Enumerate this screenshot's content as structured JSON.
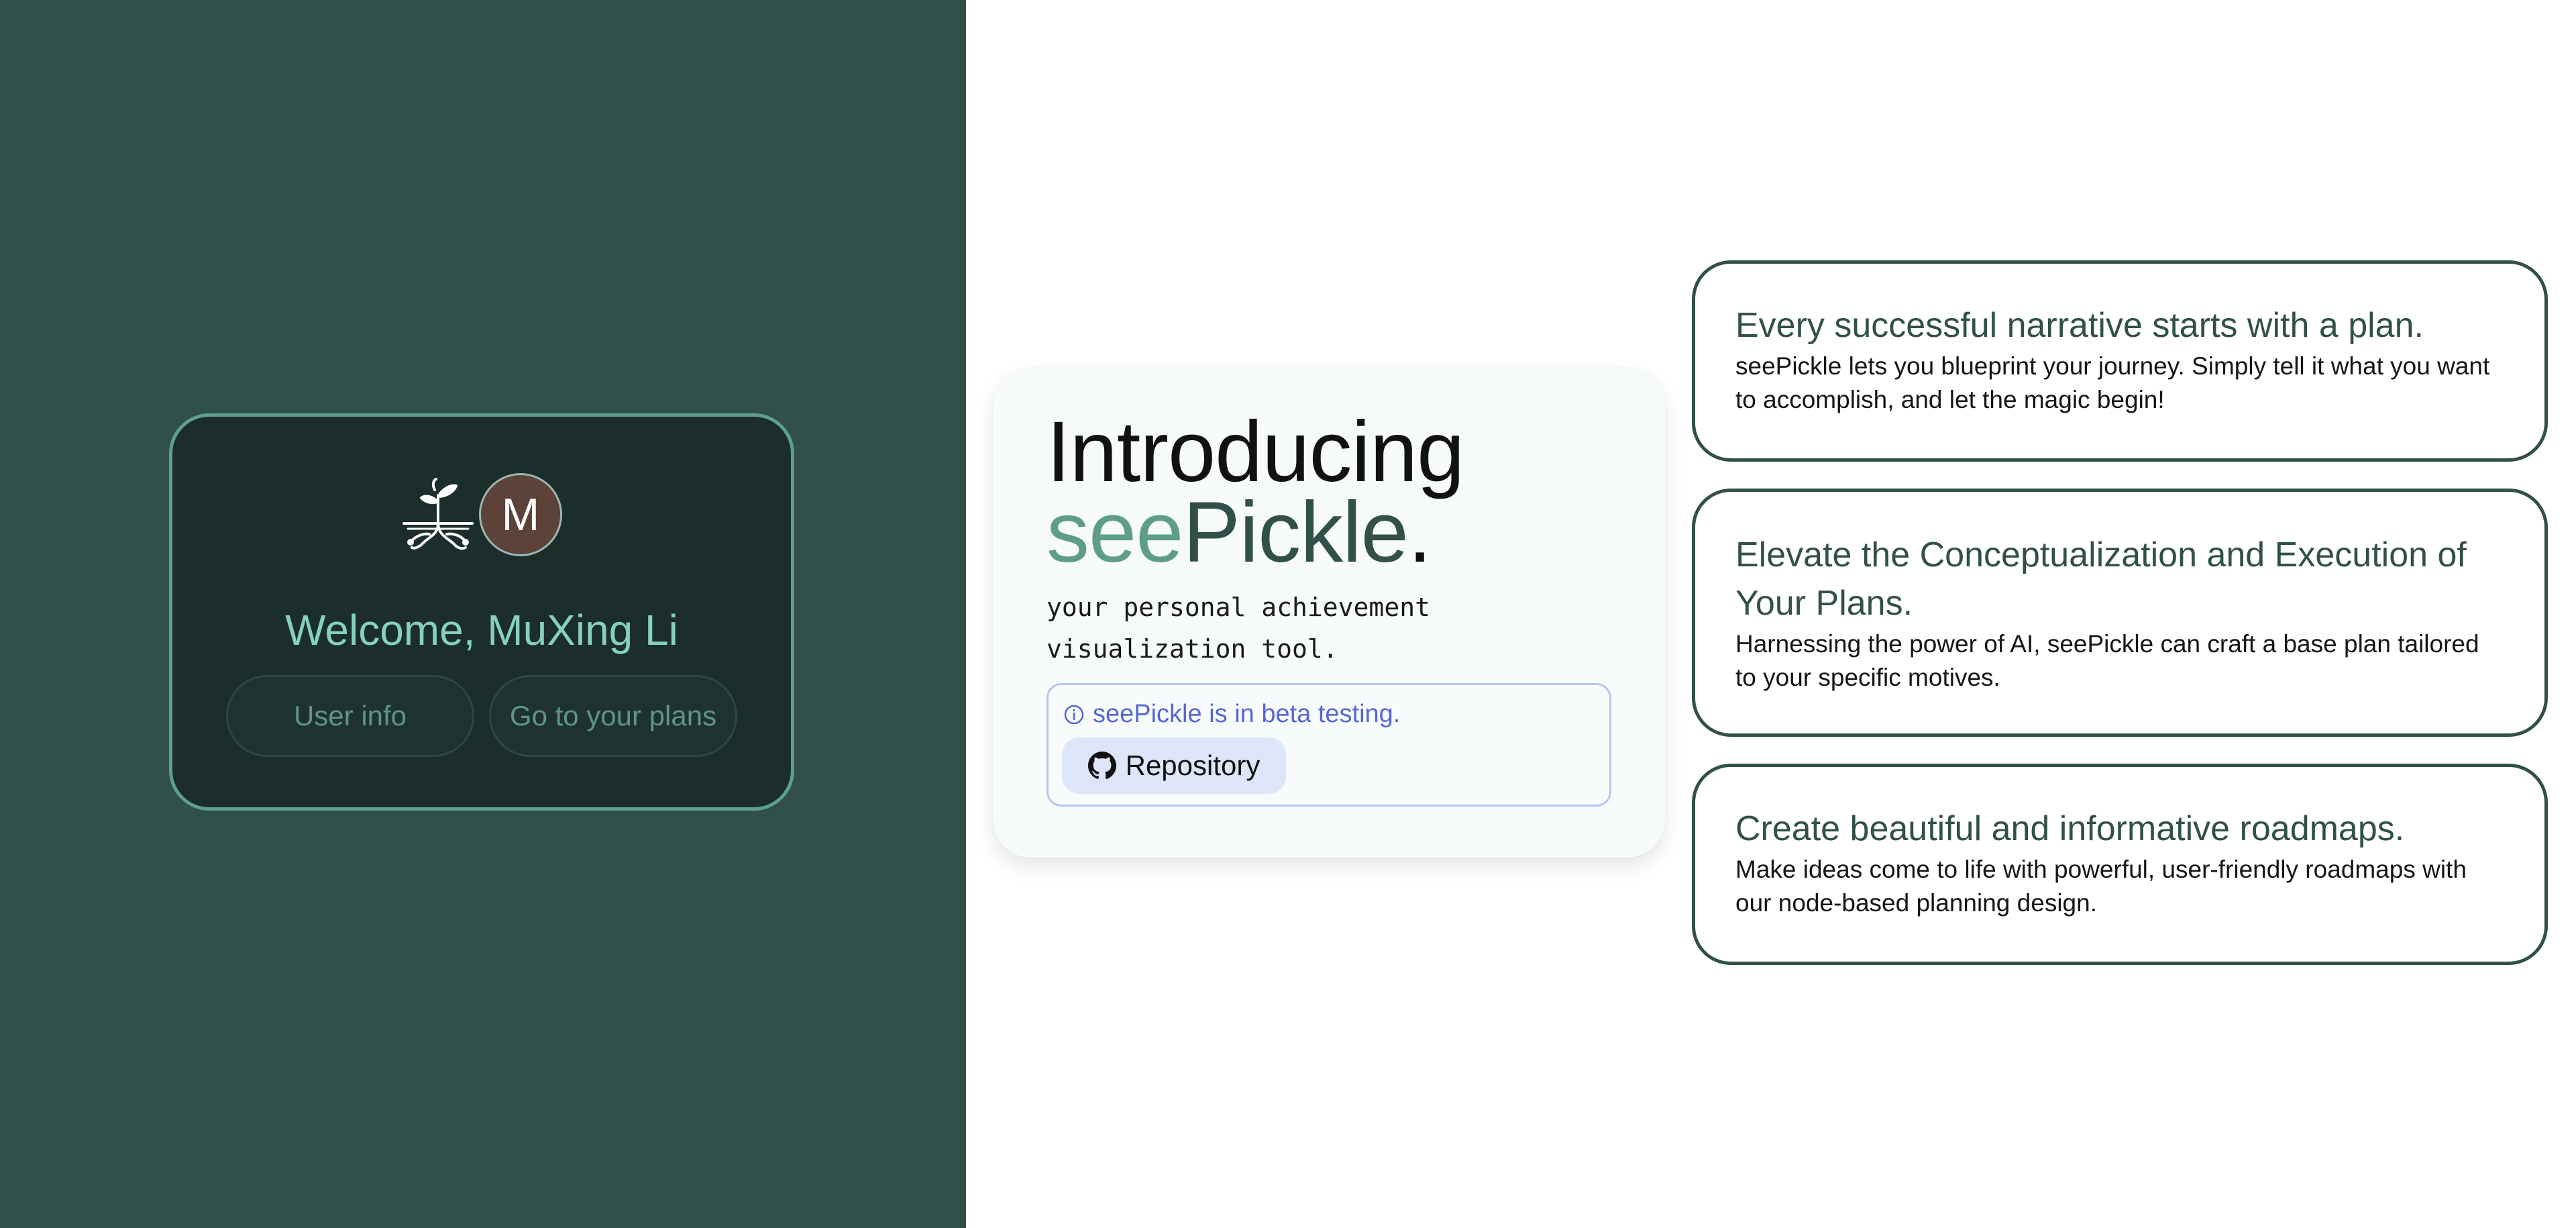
{
  "welcome": {
    "avatar_initial": "M",
    "greeting": "Welcome, MuXing Li",
    "buttons": {
      "user_info": "User info",
      "go_to_plans": "Go to your plans"
    }
  },
  "intro": {
    "title": "Introducing",
    "brand": {
      "see": "see",
      "pickle": "Pickle",
      "dot": "."
    },
    "tagline": "your personal achievement visualization tool.",
    "beta_notice": "seePickle is in beta testing.",
    "repo_button": "Repository"
  },
  "features": [
    {
      "title": "Every successful narrative starts with a plan.",
      "body": "seePickle lets you blueprint your journey. Simply tell it what you want to accomplish, and let the magic begin!"
    },
    {
      "title": "Elevate the Conceptualization and Execution of Your Plans.",
      "body": "Harnessing the power of AI, seePickle can craft a base plan tailored to your specific motives."
    },
    {
      "title": "Create beautiful and informative roadmaps.",
      "body": "Make ideas come to life with powerful, user-friendly roadmaps with our node-based planning design."
    }
  ],
  "colors": {
    "left_panel_bg": "#315049",
    "card_bg": "#1b2e2b",
    "accent": "#5ea08d",
    "greeting_text": "#86d1bb",
    "brand_dark": "#315049",
    "brand_light": "#5e9d8a",
    "beta_text": "#5567d4"
  },
  "icons": {
    "logo": "sprout-roots-icon",
    "info": "info-circle-icon",
    "repo": "github-icon"
  }
}
